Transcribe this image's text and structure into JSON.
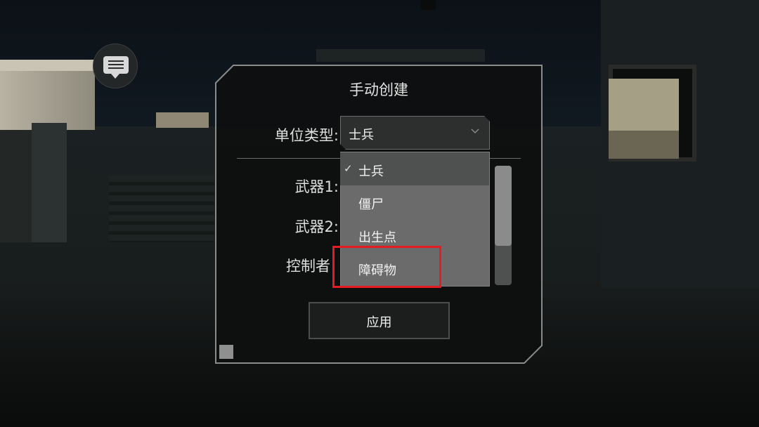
{
  "dialog": {
    "title": "手动创建",
    "unit_type_label": "单位类型:",
    "weapon1_label": "武器1:",
    "weapon2_label": "武器2:",
    "controller_label": "控制者",
    "unit_type_value": "士兵",
    "apply_label": "应用"
  },
  "dropdown": {
    "options": [
      {
        "label": "士兵",
        "selected": true
      },
      {
        "label": "僵尸",
        "selected": false
      },
      {
        "label": "出生点",
        "selected": false
      },
      {
        "label": "障碍物",
        "selected": false
      }
    ],
    "highlighted_option": "障碍物"
  },
  "colors": {
    "highlight_border": "#e61a22",
    "dialog_bg": "#0e0f0f",
    "dropdown_bg": "#6b6b6b"
  },
  "icons": {
    "chat": "chat-bubble-icon",
    "check": "check-icon",
    "chevron": "chevron-down-icon"
  }
}
